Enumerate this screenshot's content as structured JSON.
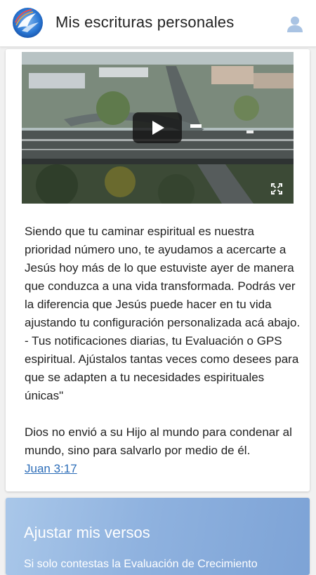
{
  "header": {
    "title": "Mis escrituras personales",
    "logo_icon": "dove-globe-logo-icon",
    "user_icon": "user-avatar-icon"
  },
  "video": {
    "play_icon": "play-icon",
    "fullscreen_icon": "fullscreen-icon"
  },
  "intro": {
    "paragraph": "Siendo que tu caminar espiritual es nuestra prioridad número uno, te ayudamos a acercarte a Jesús hoy más de lo que estuviste ayer de manera que conduzca a una vida transformada. Podrás ver la diferencia que Jesús puede hacer en tu vida ajustando tu configuración personalizada acá abajo. - Tus notificaciones diarias, tu Evaluación o GPS espiritual. Ajústalos tantas veces como desees para que se adapten a tu necesidades espirituales únicas\"",
    "verse_text": "Dios no envió a su Hijo al mundo para condenar al mundo, sino para salvarlo por medio de él.",
    "verse_link": " Juan 3:17 "
  },
  "settings_card": {
    "title": "Ajustar mis versos",
    "subtitle": "Si solo contestas la Evaluación de Crecimiento"
  },
  "colors": {
    "link": "#2c6db8",
    "card_gradient_start": "#a9c7e9",
    "card_gradient_end": "#7da3d6"
  }
}
